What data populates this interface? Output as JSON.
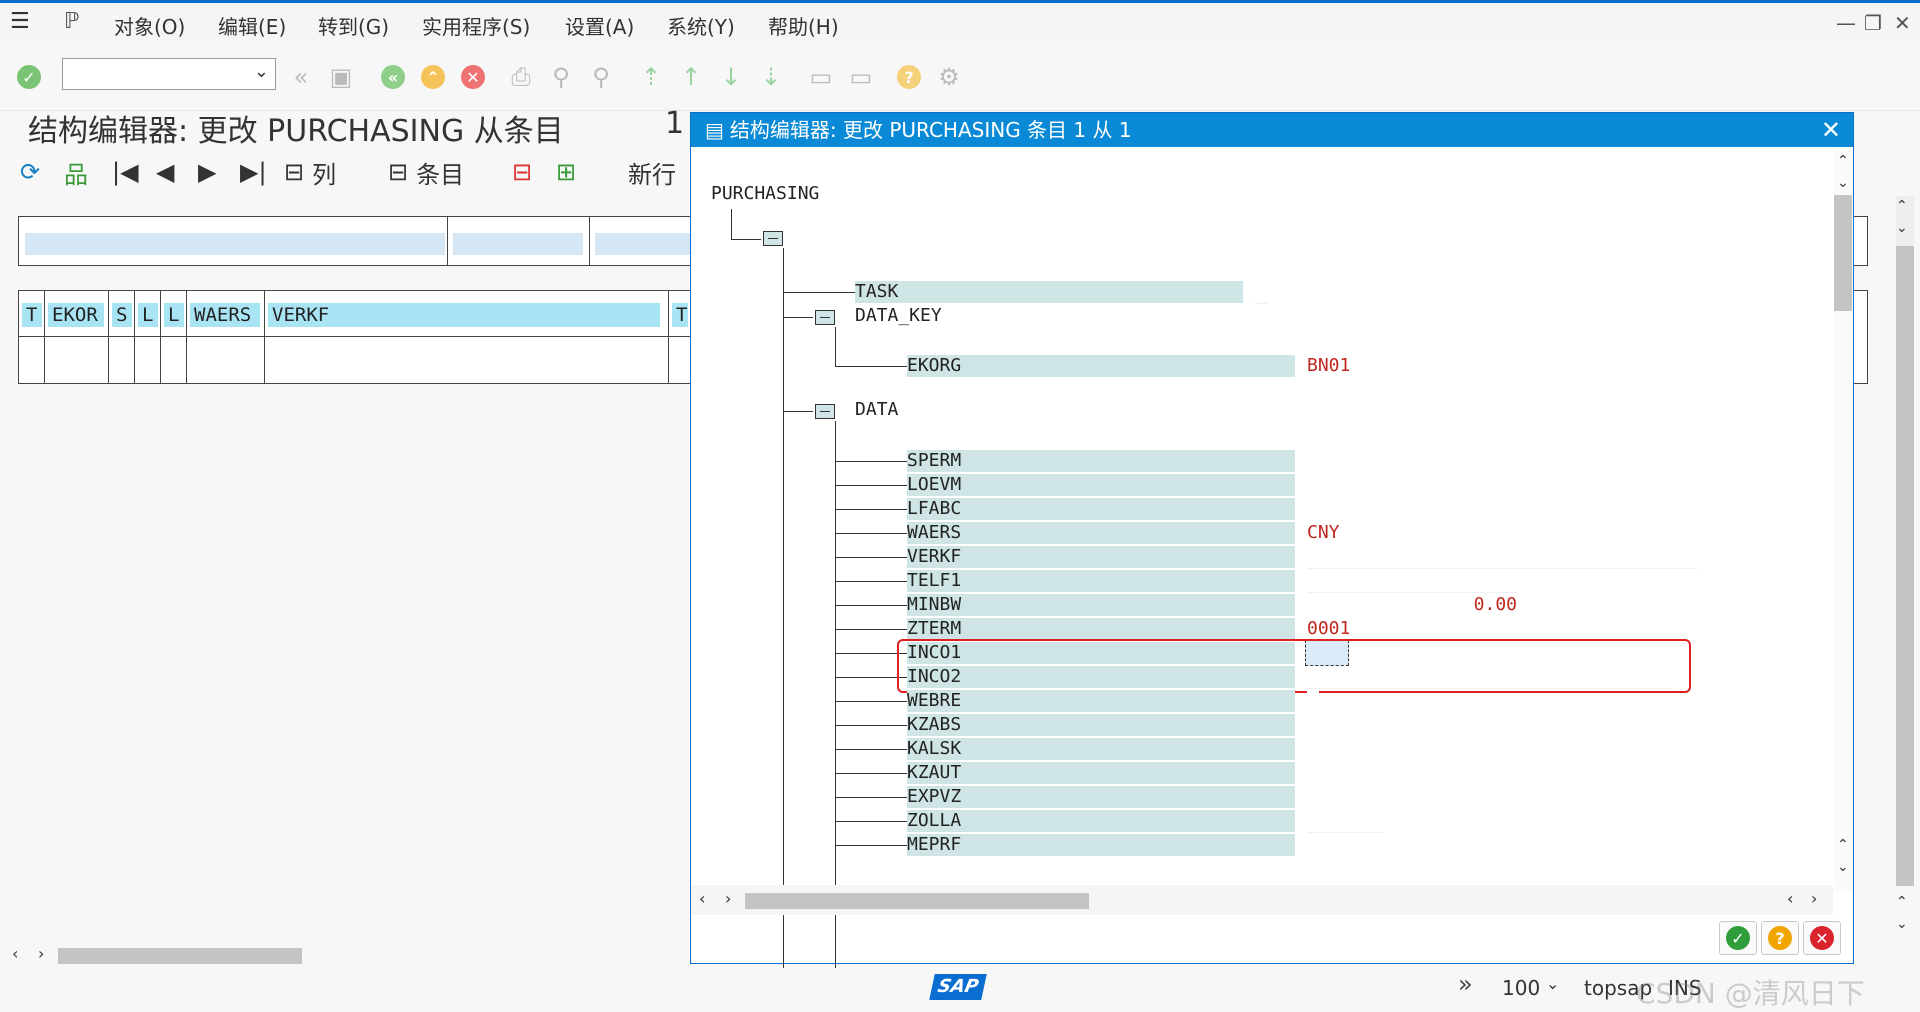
{
  "menu": {
    "items": [
      "对象(O)",
      "编辑(E)",
      "转到(G)",
      "实用程序(S)",
      "设置(A)",
      "系统(Y)",
      "帮助(H)"
    ]
  },
  "page": {
    "title": "结构编辑器: 更改 PURCHASING 从条目",
    "count": "1"
  },
  "app_toolbar": {
    "column_label": "列",
    "entry_label": "条目",
    "new_row_label": "新行"
  },
  "bg_table": {
    "columns": [
      "T",
      "EKOR",
      "S",
      "L",
      "L",
      "WAERS",
      "VERKF",
      "T"
    ]
  },
  "dialog": {
    "title": "结构编辑器: 更改 PURCHASING 条目 1 从 1",
    "root": "PURCHASING",
    "task": "TASK",
    "data_key": "DATA_KEY",
    "ekorg": "EKORG",
    "ekorg_value": "BN01",
    "data": "DATA",
    "fields": [
      {
        "name": "SPERM",
        "value": ""
      },
      {
        "name": "LOEVM",
        "value": ""
      },
      {
        "name": "LFABC",
        "value": ""
      },
      {
        "name": "WAERS",
        "value": "CNY"
      },
      {
        "name": "VERKF",
        "value": ""
      },
      {
        "name": "TELF1",
        "value": ""
      },
      {
        "name": "MINBW",
        "value": "0.00"
      },
      {
        "name": "ZTERM",
        "value": "0001"
      },
      {
        "name": "INCO1",
        "value": ""
      },
      {
        "name": "INCO2",
        "value": ""
      },
      {
        "name": "WEBRE",
        "value": ""
      },
      {
        "name": "KZABS",
        "value": ""
      },
      {
        "name": "KALSK",
        "value": ""
      },
      {
        "name": "KZAUT",
        "value": ""
      },
      {
        "name": "EXPVZ",
        "value": ""
      },
      {
        "name": "ZOLLA",
        "value": ""
      },
      {
        "name": "MEPRF",
        "value": ""
      }
    ]
  },
  "status": {
    "zoom": "100",
    "system": "topsap",
    "mode": "INS",
    "logo": "SAP",
    "watermark": "CSDN @清风日下"
  },
  "colors": {
    "accent": "#0a8ad6",
    "field_bg": "#cfe4e4",
    "value_red": "#c0281f",
    "highlight": "#e02020",
    "header_cell": "#a9e4f4"
  }
}
